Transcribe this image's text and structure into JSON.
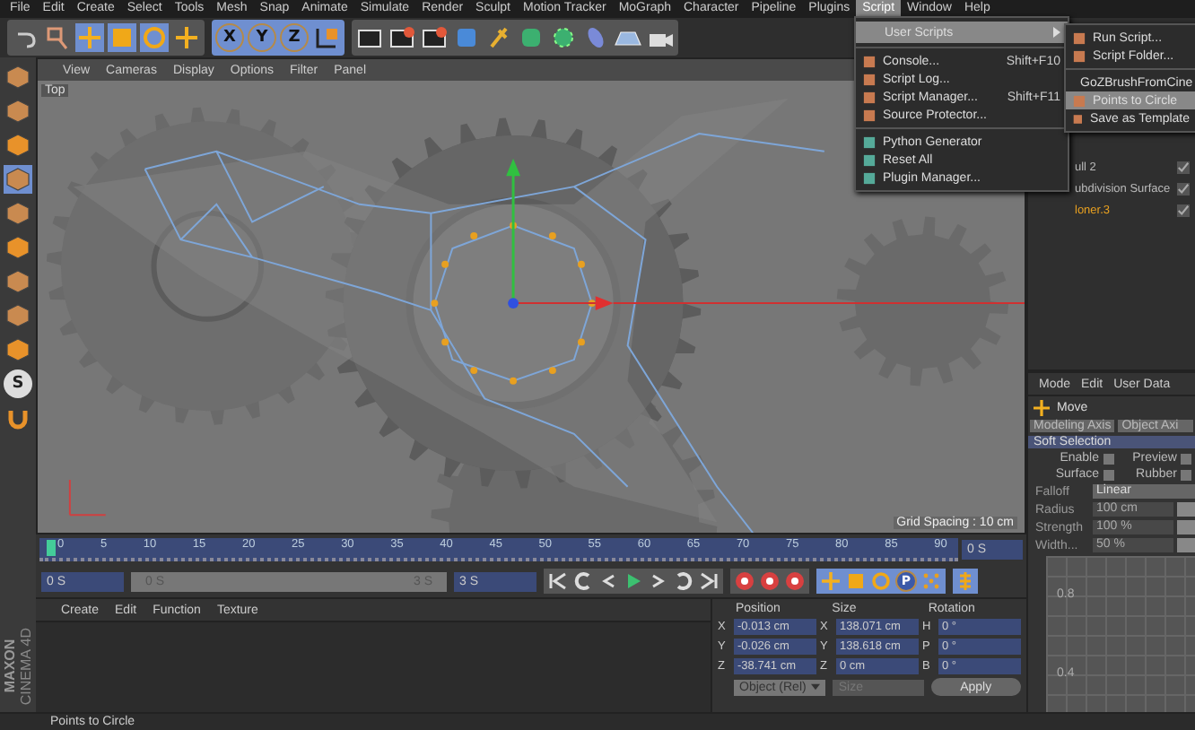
{
  "menu_bar": [
    {
      "label": "File",
      "selected": false
    },
    {
      "label": "Edit",
      "selected": false
    },
    {
      "label": "Create",
      "selected": false
    },
    {
      "label": "Select",
      "selected": false
    },
    {
      "label": "Tools",
      "selected": false
    },
    {
      "label": "Mesh",
      "selected": false
    },
    {
      "label": "Snap",
      "selected": false
    },
    {
      "label": "Animate",
      "selected": false
    },
    {
      "label": "Simulate",
      "selected": false
    },
    {
      "label": "Render",
      "selected": false
    },
    {
      "label": "Sculpt",
      "selected": false
    },
    {
      "label": "Motion Tracker",
      "selected": false
    },
    {
      "label": "MoGraph",
      "selected": false
    },
    {
      "label": "Character",
      "selected": false
    },
    {
      "label": "Pipeline",
      "selected": false
    },
    {
      "label": "Plugins",
      "selected": false
    },
    {
      "label": "Script",
      "selected": true
    },
    {
      "label": "Window",
      "selected": false
    },
    {
      "label": "Help",
      "selected": false
    }
  ],
  "toolbar": {
    "axis_buttons": [
      "X",
      "Y",
      "Z"
    ]
  },
  "script_menu": {
    "items": [
      {
        "kind": "submenu",
        "label": "User Scripts",
        "selected": true
      },
      {
        "kind": "separator"
      },
      {
        "kind": "item",
        "label": "Console...",
        "shortcut": "Shift+F10",
        "selected": false
      },
      {
        "kind": "item",
        "label": "Script Log...",
        "selected": false
      },
      {
        "kind": "item",
        "label": "Script Manager...",
        "shortcut": "Shift+F11",
        "selected": false
      },
      {
        "kind": "item",
        "label": "Source Protector...",
        "selected": false
      },
      {
        "kind": "separator"
      },
      {
        "kind": "item",
        "label": "Python Generator",
        "selected": false
      },
      {
        "kind": "item",
        "label": "Reset All",
        "selected": false
      },
      {
        "kind": "item",
        "label": "Plugin Manager...",
        "selected": false
      }
    ]
  },
  "user_scripts_menu": {
    "items": [
      {
        "kind": "item",
        "label": "Run Script...",
        "selected": false
      },
      {
        "kind": "item",
        "label": "Script Folder...",
        "selected": false
      },
      {
        "kind": "separator"
      },
      {
        "kind": "item",
        "label": "GoZBrushFromCine",
        "selected": false
      },
      {
        "kind": "item",
        "label": "Points to Circle",
        "selected": true
      },
      {
        "kind": "item",
        "label": "Save as Template",
        "selected": false
      }
    ]
  },
  "left_toolbar": {
    "letter_button": "S",
    "logo": [
      "MAXON",
      "CINEMA 4D"
    ]
  },
  "viewport": {
    "menu": [
      "View",
      "Cameras",
      "Display",
      "Options",
      "Filter",
      "Panel"
    ],
    "view_label": "Top",
    "grid_spacing": "Grid Spacing : 10 cm"
  },
  "object_manager": {
    "objects": [
      {
        "name": "ull 2",
        "selected": false
      },
      {
        "name": "ubdivision Surface",
        "selected": false
      },
      {
        "name": "loner.3",
        "selected": true
      }
    ]
  },
  "attributes": {
    "menu": [
      "Mode",
      "Edit",
      "User Data"
    ],
    "tool": "Move",
    "tabs": [
      "Modeling Axis",
      "Object Axi"
    ],
    "section": "Soft Selection",
    "checkboxes": [
      {
        "label": "Enable",
        "checked": false
      },
      {
        "label": "Preview",
        "checked": false
      },
      {
        "label": "Surface",
        "checked": false
      },
      {
        "label": "Rubber",
        "checked": false
      }
    ],
    "fields": [
      {
        "kind": "dropdown",
        "label": "Falloff",
        "value": "Linear"
      },
      {
        "kind": "number",
        "label": "Radius",
        "value": "100 cm"
      },
      {
        "kind": "number",
        "label": "Strength",
        "value": "100 %"
      },
      {
        "kind": "number",
        "label": "Width...",
        "value": "50 %"
      }
    ],
    "graph_labels": [
      "0.8",
      "0.4"
    ]
  },
  "timeline": {
    "ticks": [
      "0",
      "5",
      "10",
      "15",
      "20",
      "25",
      "30",
      "35",
      "40",
      "45",
      "50",
      "55",
      "60",
      "65",
      "70",
      "75",
      "80",
      "85",
      "90"
    ],
    "end_field": "0 S"
  },
  "transport": {
    "start": "0 S",
    "range": {
      "start": "0 S",
      "end": "3 S",
      "level": 1
    },
    "end": "3 S",
    "key_button": "P"
  },
  "material_manager": {
    "menu": [
      "Create",
      "Edit",
      "Function",
      "Texture"
    ]
  },
  "coordinates": {
    "headers": [
      "Position",
      "Size",
      "Rotation"
    ],
    "rows": [
      {
        "axis": "X",
        "position": "-0.013 cm",
        "size_axis": "X",
        "size": "138.071 cm",
        "rotation_axis": "H",
        "rotation": "0 °"
      },
      {
        "axis": "Y",
        "position": "-0.026 cm",
        "size_axis": "Y",
        "size": "138.618 cm",
        "rotation_axis": "P",
        "rotation": "0 °"
      },
      {
        "axis": "Z",
        "position": "-38.741 cm",
        "size_axis": "Z",
        "size": "0 cm",
        "rotation_axis": "B",
        "rotation": "0 °"
      }
    ],
    "mode_dropdown": "Object (Rel)",
    "size_dropdown": {
      "label": "Size",
      "disabled": true
    },
    "apply": "Apply"
  },
  "status_bar": "Points to Circle"
}
